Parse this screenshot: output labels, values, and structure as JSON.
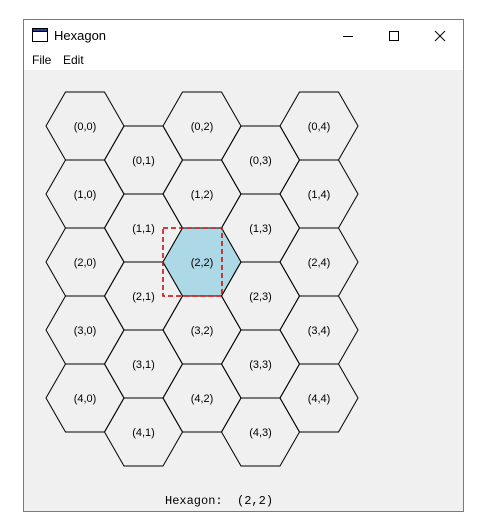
{
  "window": {
    "title": "Hexagon"
  },
  "menu": {
    "file": "File",
    "edit": "Edit"
  },
  "grid": {
    "rows": 5,
    "cols": 5,
    "cells": [
      [
        "(0,0)",
        "(0,1)",
        "(0,2)",
        "(0,3)",
        "(0,4)"
      ],
      [
        "(1,0)",
        "(1,1)",
        "(1,2)",
        "(1,3)",
        "(1,4)"
      ],
      [
        "(2,0)",
        "(2,1)",
        "(2,2)",
        "(2,3)",
        "(2,4)"
      ],
      [
        "(3,0)",
        "(3,1)",
        "(3,2)",
        "(3,3)",
        "(3,4)"
      ],
      [
        "(4,0)",
        "(4,1)",
        "(4,2)",
        "(4,3)",
        "(4,4)"
      ]
    ],
    "selected": "(2,2)",
    "selected_fill": "#add8e6",
    "selection_box_color": "#cc0000"
  },
  "status": {
    "label": "Hexagon:",
    "value": "(2,2)"
  }
}
